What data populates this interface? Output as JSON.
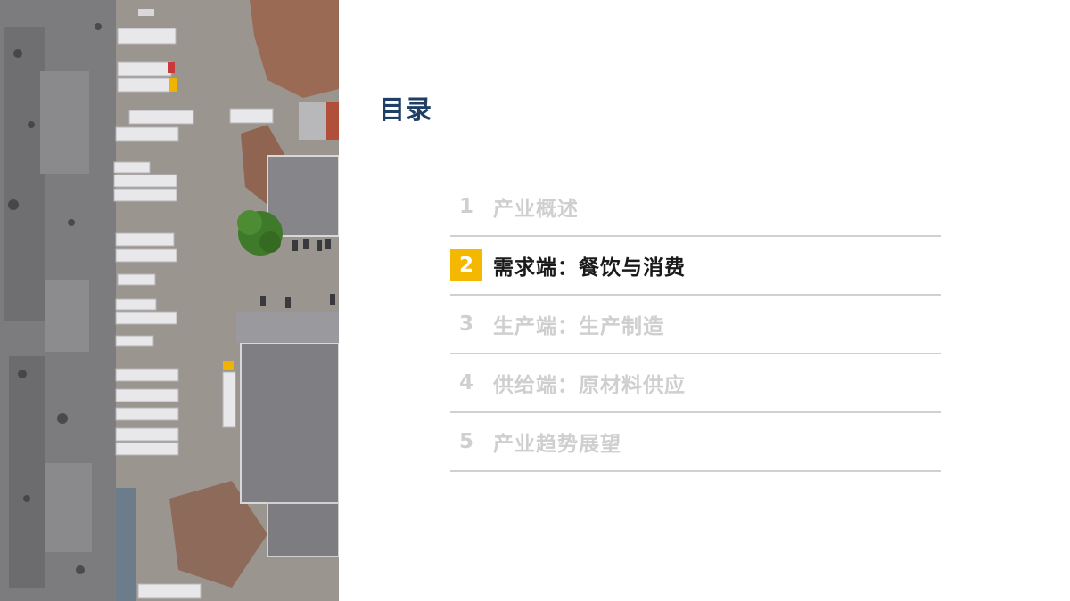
{
  "title": "目录",
  "toc": [
    {
      "number": "1",
      "label": "产业概述",
      "active": false
    },
    {
      "number": "2",
      "label": "需求端：餐饮与消费",
      "active": true
    },
    {
      "number": "3",
      "label": "生产端：生产制造",
      "active": false
    },
    {
      "number": "4",
      "label": "供给端：原材料供应",
      "active": false
    },
    {
      "number": "5",
      "label": "产业趋势展望",
      "active": false
    }
  ],
  "colors": {
    "title": "#1f3f66",
    "active_badge": "#f5b800",
    "inactive_text": "#cfcfcf",
    "divider": "#d0d0d0"
  },
  "image": {
    "icon": "aerial-warehouse-photo"
  }
}
